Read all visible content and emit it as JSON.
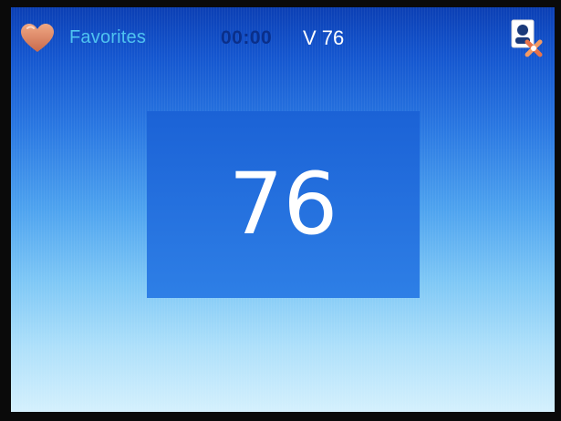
{
  "header": {
    "favorites_label": "Favorites",
    "time": "00:00",
    "channel_label": "V 76",
    "heart_icon": "heart-icon",
    "settings_icon": "settings-tool-icon"
  },
  "main": {
    "channel_number": "76"
  },
  "colors": {
    "gradient_top": "#0b3fb4",
    "gradient_bottom": "#d4f0fd",
    "channel_box": "#1b62d6",
    "favorites_text": "#4fc3f0",
    "time_text": "#0a2f8a",
    "heart": "#d07a5c"
  }
}
